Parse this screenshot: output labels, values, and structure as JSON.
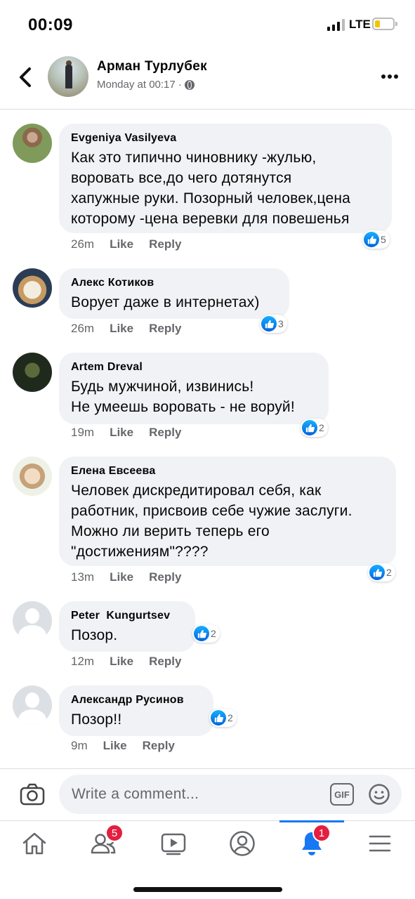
{
  "status_bar": {
    "time": "00:09",
    "network": "LTE"
  },
  "header": {
    "name": "Арман Турлубек",
    "timestamp": "Monday at 00:17",
    "separator": "·"
  },
  "comments": [
    {
      "author": "Evgeniya Vasilyeva",
      "text": "Как это типично чиновнику -жулью,\nворовать все,до чего дотянутся\nхапужные руки. Позорный человек,цена\nкоторому -цена веревки для повешенья",
      "time": "26m",
      "like": "Like",
      "reply": "Reply",
      "reactions": "5"
    },
    {
      "author": "Алекс Котиков",
      "text": "Ворует даже в интернетах)",
      "time": "26m",
      "like": "Like",
      "reply": "Reply",
      "reactions": "3"
    },
    {
      "author": "Artem Dreval",
      "text": "Будь мужчиной, извинись!\nНе умеешь воровать - не воруй!",
      "time": "19m",
      "like": "Like",
      "reply": "Reply",
      "reactions": "2"
    },
    {
      "author": "Елена Евсеева",
      "text": "Человек дискредитировал себя, как\nработник, присвоив себе чужие заслуги.\nМожно ли верить теперь его\n\"достижениям\"????",
      "time": "13m",
      "like": "Like",
      "reply": "Reply",
      "reactions": "2"
    },
    {
      "author": "Peter  Kungurtsev",
      "text": "Позор.",
      "time": "12m",
      "like": "Like",
      "reply": "Reply",
      "reactions": "2"
    },
    {
      "author": "Александр Русинов",
      "text": "Позор!!",
      "time": "9m",
      "like": "Like",
      "reply": "Reply",
      "reactions": "2"
    }
  ],
  "composer": {
    "placeholder": "Write a comment...",
    "gif_label": "GIF"
  },
  "tabbar": {
    "tabs": [
      {
        "icon": "home-icon"
      },
      {
        "icon": "friends-icon",
        "badge": "5"
      },
      {
        "icon": "watch-icon"
      },
      {
        "icon": "profile-icon"
      },
      {
        "icon": "notifications-icon",
        "badge": "1",
        "active": true
      },
      {
        "icon": "menu-icon"
      }
    ]
  },
  "colors": {
    "accent": "#1877f2",
    "bubble": "#f0f2f5",
    "badge": "#e41e3f",
    "secondary_text": "#65676b"
  }
}
